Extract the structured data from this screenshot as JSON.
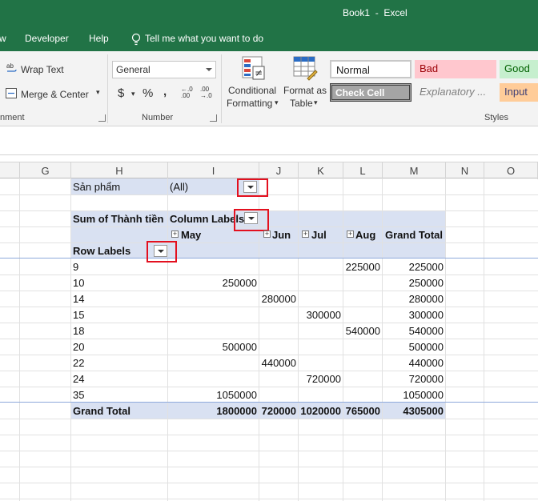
{
  "window": {
    "title": "Book1  -  Excel"
  },
  "menu": {
    "items": [
      "w",
      "Developer",
      "Help"
    ],
    "tell_me": "Tell me what you want to do"
  },
  "ribbon": {
    "alignment": {
      "wrap_text": "Wrap Text",
      "merge_center": "Merge & Center",
      "group_label": "nment"
    },
    "number": {
      "format": "General",
      "currency": "$",
      "percent": "%",
      "comma": ",",
      "inc_decimal": "←.0 .00",
      "dec_decimal": ".00 →.0",
      "group_label": "Number"
    },
    "styles": {
      "conditional": [
        "Conditional",
        "Formatting"
      ],
      "format_table": [
        "Format as",
        "Table"
      ],
      "normal": "Normal",
      "bad": "Bad",
      "good": "Good",
      "check_cell": "Check Cell",
      "explanatory": "Explanatory ...",
      "input": "Input",
      "group_label": "Styles"
    }
  },
  "columns": [
    "G",
    "H",
    "I",
    "J",
    "K",
    "L",
    "M",
    "N",
    "O"
  ],
  "pivot": {
    "filter_label": "Sản phẩm",
    "filter_value": "(All)",
    "value_label": "Sum of Thành tiền",
    "column_labels": "Column Labels",
    "row_labels": "Row Labels",
    "months": [
      "May",
      "Jun",
      "Jul",
      "Aug"
    ],
    "grand_total_label": "Grand Total",
    "rows": [
      {
        "label": "9",
        "may": "",
        "jun": "",
        "jul": "",
        "aug": "225000",
        "total": "225000"
      },
      {
        "label": "10",
        "may": "250000",
        "jun": "",
        "jul": "",
        "aug": "",
        "total": "250000"
      },
      {
        "label": "14",
        "may": "",
        "jun": "280000",
        "jul": "",
        "aug": "",
        "total": "280000"
      },
      {
        "label": "15",
        "may": "",
        "jun": "",
        "jul": "300000",
        "aug": "",
        "total": "300000"
      },
      {
        "label": "18",
        "may": "",
        "jun": "",
        "jul": "",
        "aug": "540000",
        "total": "540000"
      },
      {
        "label": "20",
        "may": "500000",
        "jun": "",
        "jul": "",
        "aug": "",
        "total": "500000"
      },
      {
        "label": "22",
        "may": "",
        "jun": "440000",
        "jul": "",
        "aug": "",
        "total": "440000"
      },
      {
        "label": "24",
        "may": "",
        "jun": "",
        "jul": "720000",
        "aug": "",
        "total": "720000"
      },
      {
        "label": "35",
        "may": "1050000",
        "jun": "",
        "jul": "",
        "aug": "",
        "total": "1050000"
      }
    ],
    "grand_total": {
      "may": "1800000",
      "jun": "720000",
      "jul": "1020000",
      "aug": "765000",
      "total": "4305000"
    }
  }
}
